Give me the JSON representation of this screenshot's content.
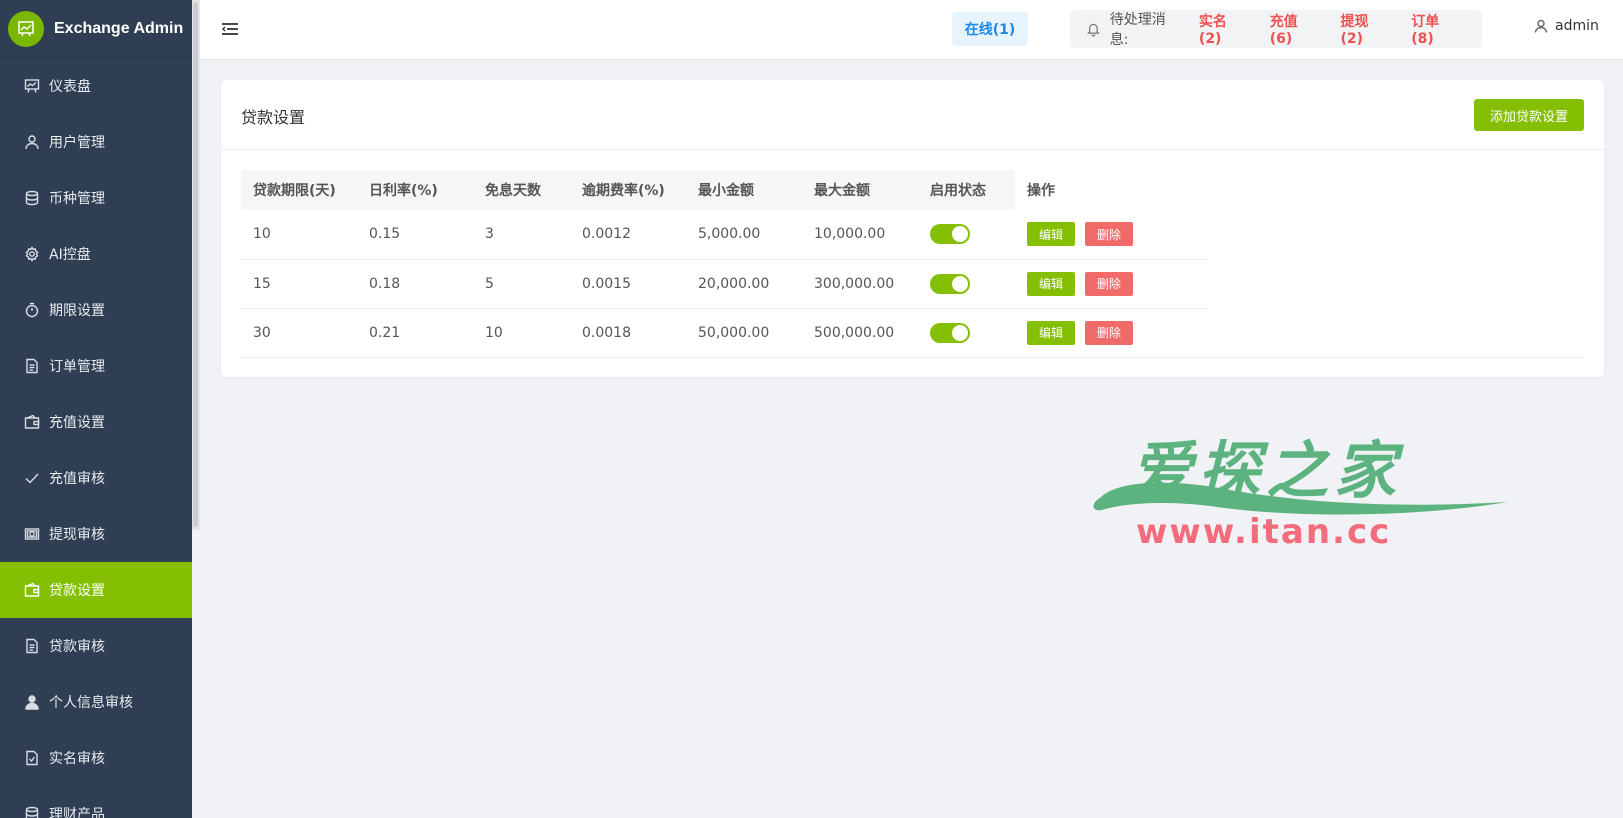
{
  "app": {
    "title": "Exchange Admin"
  },
  "sidebar": {
    "items": [
      {
        "label": "仪表盘",
        "icon": "dashboard-icon"
      },
      {
        "label": "用户管理",
        "icon": "user-icon"
      },
      {
        "label": "币种管理",
        "icon": "database-icon"
      },
      {
        "label": "AI控盘",
        "icon": "gear-icon"
      },
      {
        "label": "期限设置",
        "icon": "timer-icon"
      },
      {
        "label": "订单管理",
        "icon": "document-icon"
      },
      {
        "label": "充值设置",
        "icon": "wallet-icon"
      },
      {
        "label": "充值审核",
        "icon": "check-icon"
      },
      {
        "label": "提现审核",
        "icon": "money-icon"
      },
      {
        "label": "贷款设置",
        "icon": "wallet-icon",
        "active": true
      },
      {
        "label": "贷款审核",
        "icon": "document-icon"
      },
      {
        "label": "个人信息审核",
        "icon": "person-icon"
      },
      {
        "label": "实名审核",
        "icon": "document-check-icon"
      },
      {
        "label": "理财产品",
        "icon": "database-icon"
      }
    ]
  },
  "header": {
    "online": "在线(1)",
    "pending_label": "待处理消息:",
    "pending": [
      {
        "label": "实名(2)"
      },
      {
        "label": "充值(6)"
      },
      {
        "label": "提现(2)"
      },
      {
        "label": "订单(8)"
      }
    ],
    "user": "admin"
  },
  "card": {
    "title": "贷款设置",
    "add_button": "添加贷款设置",
    "columns": [
      "贷款期限(天)",
      "日利率(%)",
      "免息天数",
      "逾期费率(%)",
      "最小金额",
      "最大金额",
      "启用状态",
      "操作"
    ],
    "rows": [
      {
        "term": "10",
        "rate": "0.15",
        "free_days": "3",
        "overdue_rate": "0.0012",
        "min": "5,000.00",
        "max": "10,000.00",
        "enabled": true
      },
      {
        "term": "15",
        "rate": "0.18",
        "free_days": "5",
        "overdue_rate": "0.0015",
        "min": "20,000.00",
        "max": "300,000.00",
        "enabled": true
      },
      {
        "term": "30",
        "rate": "0.21",
        "free_days": "10",
        "overdue_rate": "0.0018",
        "min": "50,000.00",
        "max": "500,000.00",
        "enabled": true
      }
    ],
    "edit_label": "编辑",
    "delete_label": "删除"
  },
  "watermark": {
    "cn": "爱探之家",
    "url": "www.itan.cc"
  },
  "colors": {
    "accent": "#84bf04",
    "sidebar": "#2f3e52",
    "danger": "#f06a6a",
    "link": "#1e88e5"
  }
}
